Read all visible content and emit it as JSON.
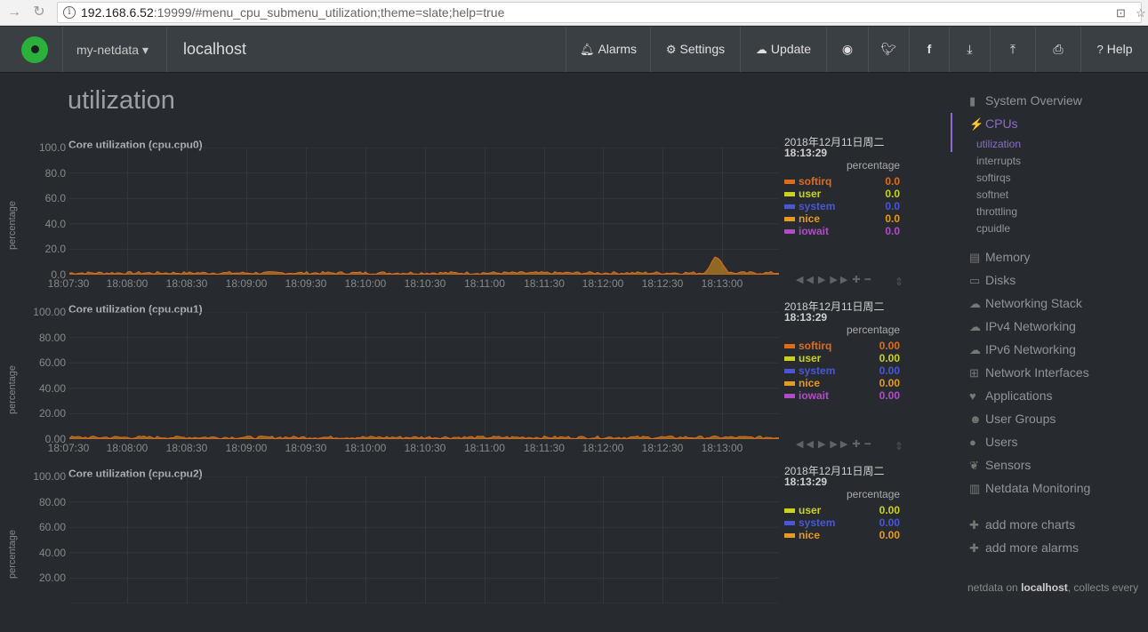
{
  "browser": {
    "url_host": "192.168.6.52",
    "url_rest": ":19999/#menu_cpu_submenu_utilization;theme=slate;help=true"
  },
  "navbar": {
    "brand": "my-netdata",
    "hostname": "localhost",
    "items": [
      {
        "name": "alarms",
        "label": "Alarms"
      },
      {
        "name": "settings",
        "label": "Settings"
      },
      {
        "name": "update",
        "label": "Update"
      },
      {
        "name": "help",
        "label": "Help"
      }
    ]
  },
  "page": {
    "title": "utilization"
  },
  "charts": [
    {
      "title": "Core utilization (cpu.cpu0)",
      "ylabel": "percentage",
      "yticks": [
        "100.0",
        "80.0",
        "60.0",
        "40.0",
        "20.0",
        "0.0"
      ],
      "xticks": [
        "18:07:30",
        "18:08:00",
        "18:08:30",
        "18:09:00",
        "18:09:30",
        "18:10:00",
        "18:10:30",
        "18:11:00",
        "18:11:30",
        "18:12:00",
        "18:12:30",
        "18:13:00"
      ],
      "date": "2018年12月11日周二",
      "time": "18:13:29",
      "unit": "percentage",
      "legend": [
        {
          "name": "softirq",
          "value": "0.0",
          "color": "#e06c1b"
        },
        {
          "name": "user",
          "value": "0.0",
          "color": "#cbd21e"
        },
        {
          "name": "system",
          "value": "0.0",
          "color": "#4a56d8"
        },
        {
          "name": "nice",
          "value": "0.0",
          "color": "#e69a1f"
        },
        {
          "name": "iowait",
          "value": "0.0",
          "color": "#b14cc6"
        }
      ]
    },
    {
      "title": "Core utilization (cpu.cpu1)",
      "ylabel": "percentage",
      "yticks": [
        "100.00",
        "80.00",
        "60.00",
        "40.00",
        "20.00",
        "0.00"
      ],
      "xticks": [
        "18:07:30",
        "18:08:00",
        "18:08:30",
        "18:09:00",
        "18:09:30",
        "18:10:00",
        "18:10:30",
        "18:11:00",
        "18:11:30",
        "18:12:00",
        "18:12:30",
        "18:13:00"
      ],
      "date": "2018年12月11日周二",
      "time": "18:13:29",
      "unit": "percentage",
      "legend": [
        {
          "name": "softirq",
          "value": "0.00",
          "color": "#e06c1b"
        },
        {
          "name": "user",
          "value": "0.00",
          "color": "#cbd21e"
        },
        {
          "name": "system",
          "value": "0.00",
          "color": "#4a56d8"
        },
        {
          "name": "nice",
          "value": "0.00",
          "color": "#e69a1f"
        },
        {
          "name": "iowait",
          "value": "0.00",
          "color": "#b14cc6"
        }
      ]
    },
    {
      "title": "Core utilization (cpu.cpu2)",
      "ylabel": "percentage",
      "yticks": [
        "100.00",
        "80.00",
        "60.00",
        "40.00",
        "20.00"
      ],
      "xticks": [],
      "date": "2018年12月11日周二",
      "time": "18:13:29",
      "unit": "percentage",
      "legend": [
        {
          "name": "user",
          "value": "0.00",
          "color": "#cbd21e"
        },
        {
          "name": "system",
          "value": "0.00",
          "color": "#4a56d8"
        },
        {
          "name": "nice",
          "value": "0.00",
          "color": "#e69a1f"
        }
      ]
    }
  ],
  "sidebar": {
    "items": [
      {
        "label": "System Overview",
        "icon": "bookmark-icon",
        "glyph": "▮"
      },
      {
        "label": "CPUs",
        "icon": "bolt-icon",
        "glyph": "⚡"
      },
      {
        "label": "Memory",
        "icon": "memory-icon",
        "glyph": "▤"
      },
      {
        "label": "Disks",
        "icon": "hdd-icon",
        "glyph": "▭"
      },
      {
        "label": "Networking Stack",
        "icon": "cloud-icon",
        "glyph": "☁"
      },
      {
        "label": "IPv4 Networking",
        "icon": "cloud-icon",
        "glyph": "☁"
      },
      {
        "label": "IPv6 Networking",
        "icon": "cloud-icon",
        "glyph": "☁"
      },
      {
        "label": "Network Interfaces",
        "icon": "sitemap-icon",
        "glyph": "⊞"
      },
      {
        "label": "Applications",
        "icon": "heartbeat-icon",
        "glyph": "♥"
      },
      {
        "label": "User Groups",
        "icon": "users-icon",
        "glyph": "☻"
      },
      {
        "label": "Users",
        "icon": "user-icon",
        "glyph": "●"
      },
      {
        "label": "Sensors",
        "icon": "leaf-icon",
        "glyph": "❦"
      },
      {
        "label": "Netdata Monitoring",
        "icon": "bar-chart-icon",
        "glyph": "▥"
      }
    ],
    "subitems": [
      "utilization",
      "interrupts",
      "softirqs",
      "softnet",
      "throttling",
      "cpuidle"
    ],
    "add_charts": "add more charts",
    "add_alarms": "add more alarms",
    "footer_prefix": "netdata on ",
    "footer_host": "localhost",
    "footer_suffix": ", collects every"
  },
  "colors": {
    "accent": "#8a6cc9",
    "background": "#272b30",
    "navbar": "#3a3f44"
  }
}
